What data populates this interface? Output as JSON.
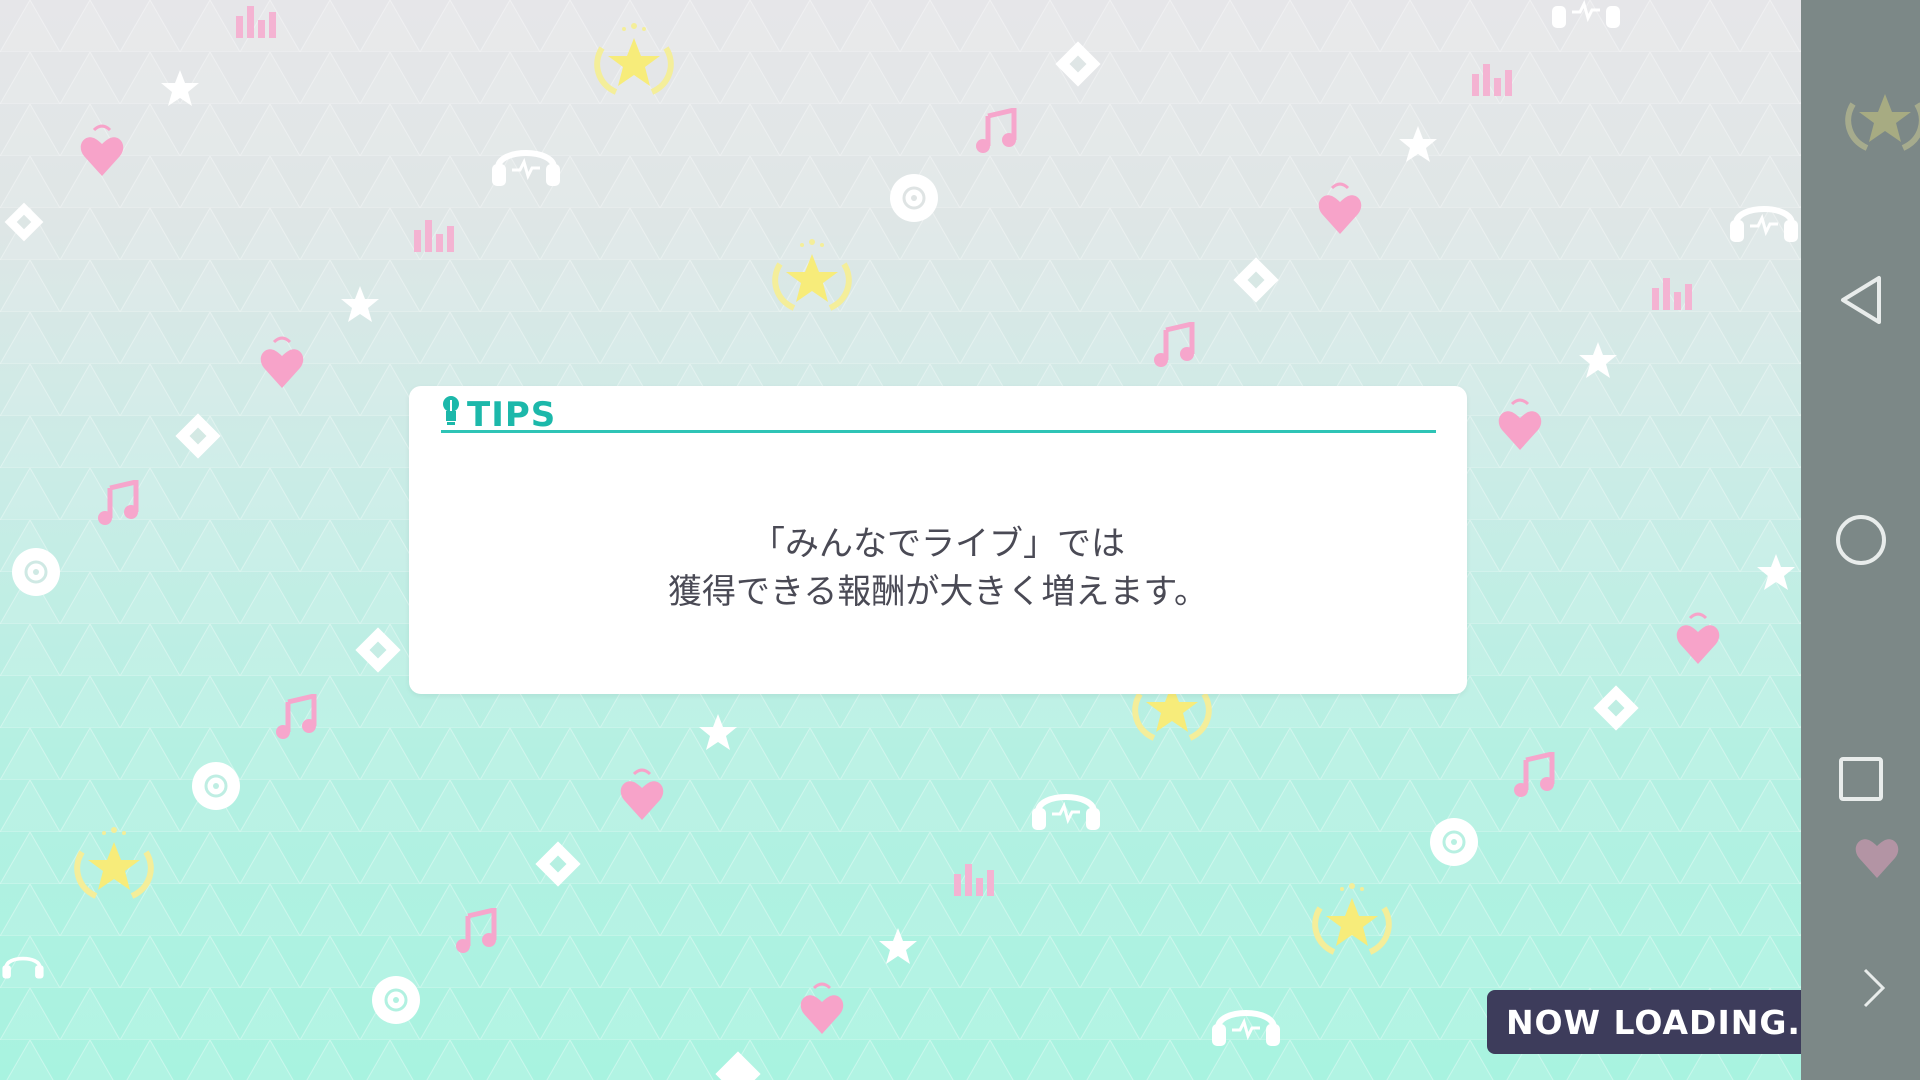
{
  "tips": {
    "title": "TIPS",
    "line1": "「みんなでライブ」では",
    "line2": "獲得できる報酬が大きく増えます。"
  },
  "loading": {
    "text": "NOW LOADING..."
  },
  "nav": {
    "back_icon": "triangle-back-icon",
    "home_icon": "circle-home-icon",
    "recents_icon": "square-recents-icon"
  },
  "colors": {
    "accent": "#1cb8aa",
    "badge_bg": "#3d3c5b",
    "text": "#4a4a55",
    "pink_deco": "#f6a0c8",
    "gold_deco": "#f4ee9a"
  }
}
